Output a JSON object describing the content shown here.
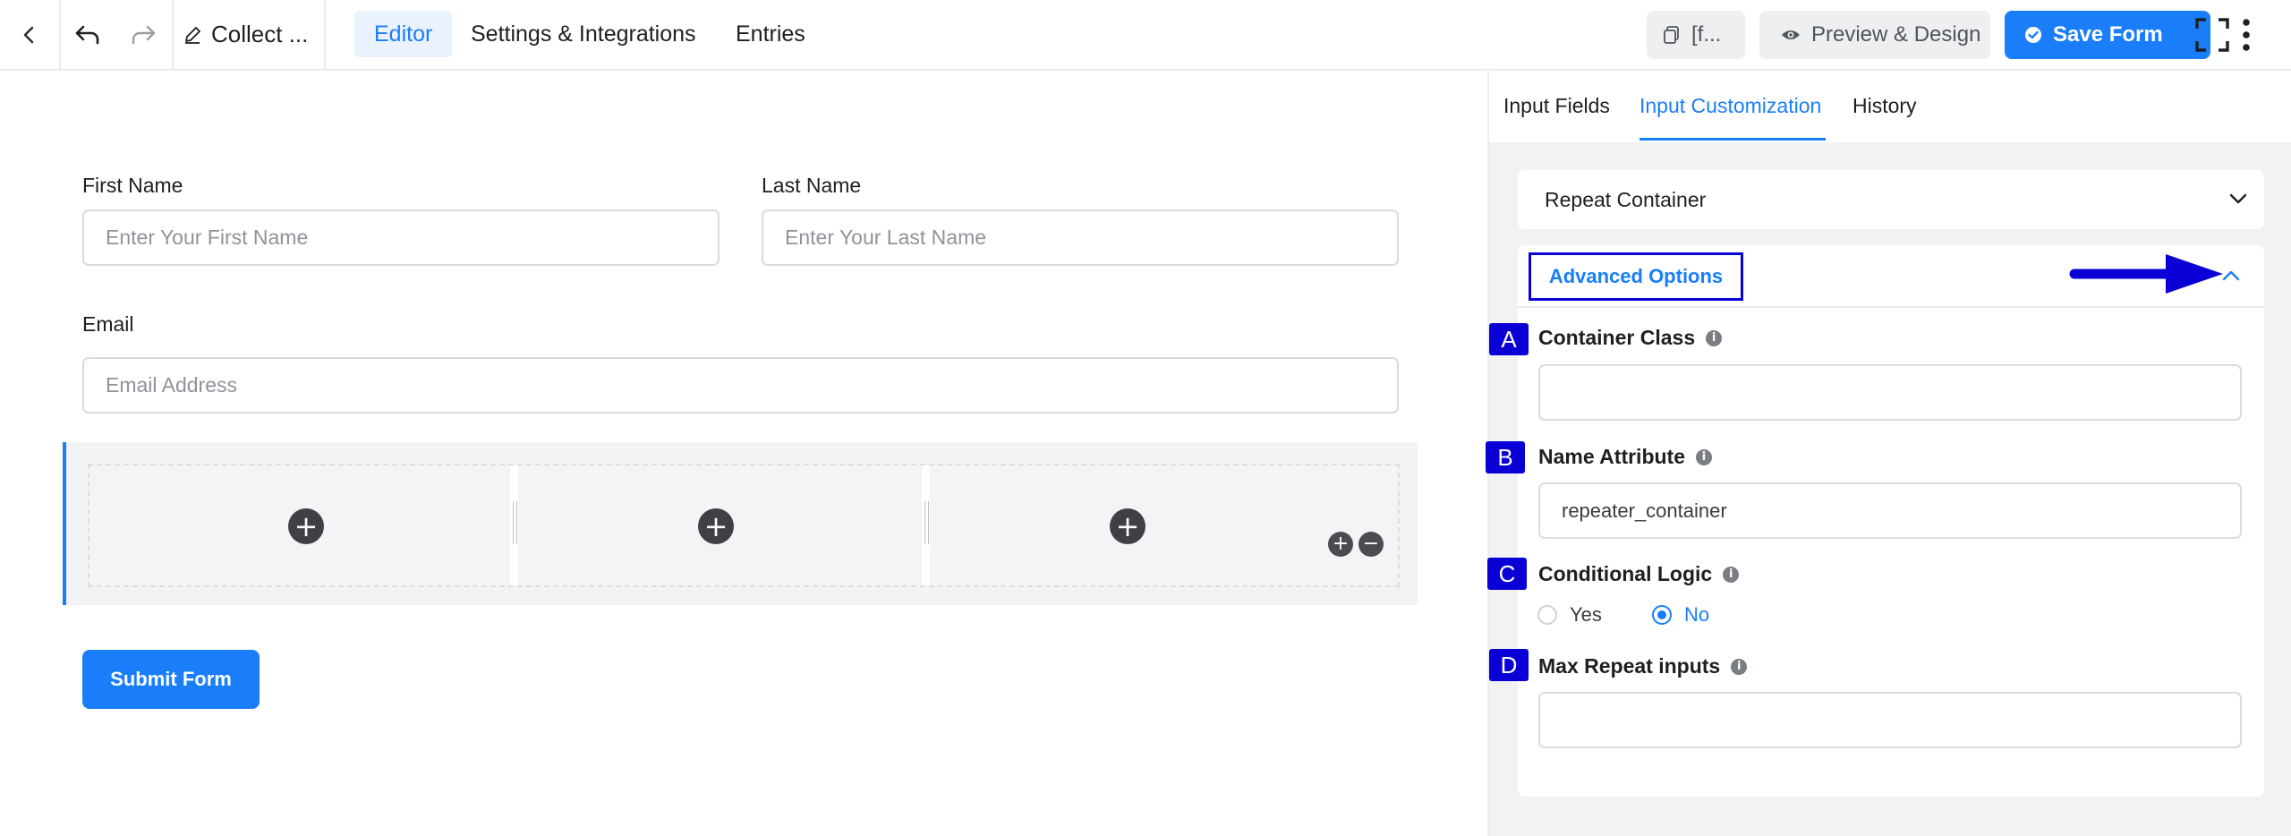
{
  "topbar": {
    "form_title": "Collect ...",
    "tabs": [
      {
        "label": "Editor"
      },
      {
        "label": "Settings & Integrations"
      },
      {
        "label": "Entries"
      }
    ],
    "shortcode_label": "[f...",
    "preview_label": "Preview & Design",
    "save_label": "Save Form"
  },
  "form": {
    "first_name": {
      "label": "First Name",
      "placeholder": "Enter Your First Name"
    },
    "last_name": {
      "label": "Last Name",
      "placeholder": "Enter Your Last Name"
    },
    "email": {
      "label": "Email",
      "placeholder": "Email Address"
    },
    "submit_label": "Submit Form"
  },
  "sidebar": {
    "tabs": [
      {
        "label": "Input Fields"
      },
      {
        "label": "Input Customization"
      },
      {
        "label": "History"
      }
    ],
    "repeat_container_title": "Repeat Container",
    "advanced_options_title": "Advanced Options",
    "fields": {
      "container_class": {
        "badge": "A",
        "label": "Container Class",
        "value": ""
      },
      "name_attribute": {
        "badge": "B",
        "label": "Name Attribute",
        "value": "repeater_container"
      },
      "conditional_logic": {
        "badge": "C",
        "label": "Conditional Logic",
        "options": [
          "Yes",
          "No"
        ],
        "selected": "No"
      },
      "max_repeat": {
        "badge": "D",
        "label": "Max Repeat inputs",
        "value": ""
      }
    }
  },
  "colors": {
    "accent": "#1a7efb",
    "annotation": "#0a00d6"
  }
}
